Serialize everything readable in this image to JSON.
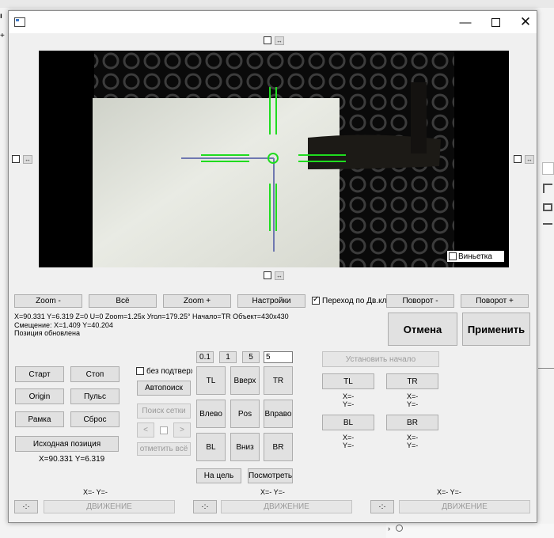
{
  "camera": {
    "vignette_label": "Виньетка"
  },
  "zoom_row": {
    "zoom_minus": "Zoom -",
    "all": "Всё",
    "zoom_plus": "Zoom +",
    "settings": "Настройки",
    "dblclick_label": "Переход по Дв.кли",
    "rotate_minus": "Поворот -",
    "rotate_plus": "Поворот +"
  },
  "status": {
    "line1": "X=90.331  Y=6.319  Z=0  U=0  Zoom=1.25x  Угол=179.25°  Начало=TR  Объект=430x430",
    "line2": "Смещение: X=1.409 Y=40.204",
    "line3": "Позиция обновлена"
  },
  "actions": {
    "cancel": "Отмена",
    "apply": "Применить"
  },
  "left_panel": {
    "start": "Старт",
    "stop": "Стоп",
    "origin": "Origin",
    "pulse": "Пульс",
    "frame": "Рамка",
    "reset": "Сброс",
    "home_position": "Исходная позиция",
    "position_readout": "X=90.331  Y=6.319"
  },
  "search_panel": {
    "no_confirm_label": "без подтверждения",
    "autosearch": "Автопоиск",
    "grid_search": "Поиск сетки",
    "prev": "<",
    "next": ">",
    "mark_all": "отметить всё"
  },
  "jog": {
    "steps": [
      "0.1",
      "1",
      "5"
    ],
    "step_value": "5",
    "tl": "TL",
    "up": "Вверх",
    "tr": "TR",
    "left": "Влево",
    "pos": "Pos",
    "right": "Вправо",
    "bl": "BL",
    "down": "Вниз",
    "br": "BR",
    "to_target": "На цель",
    "view": "Посмотреть"
  },
  "corners": {
    "set_origin": "Установить начало",
    "tl": "TL",
    "tr": "TR",
    "bl": "BL",
    "br": "BR",
    "x_empty": "X=-",
    "y_empty": "Y=-"
  },
  "bottom": {
    "xy_readout": "X=-  Y=-",
    "move_label": "ДВИЖЕНИЕ"
  },
  "colors": {
    "crosshair": "#1fdc1f",
    "aim": "#6f78b0"
  }
}
